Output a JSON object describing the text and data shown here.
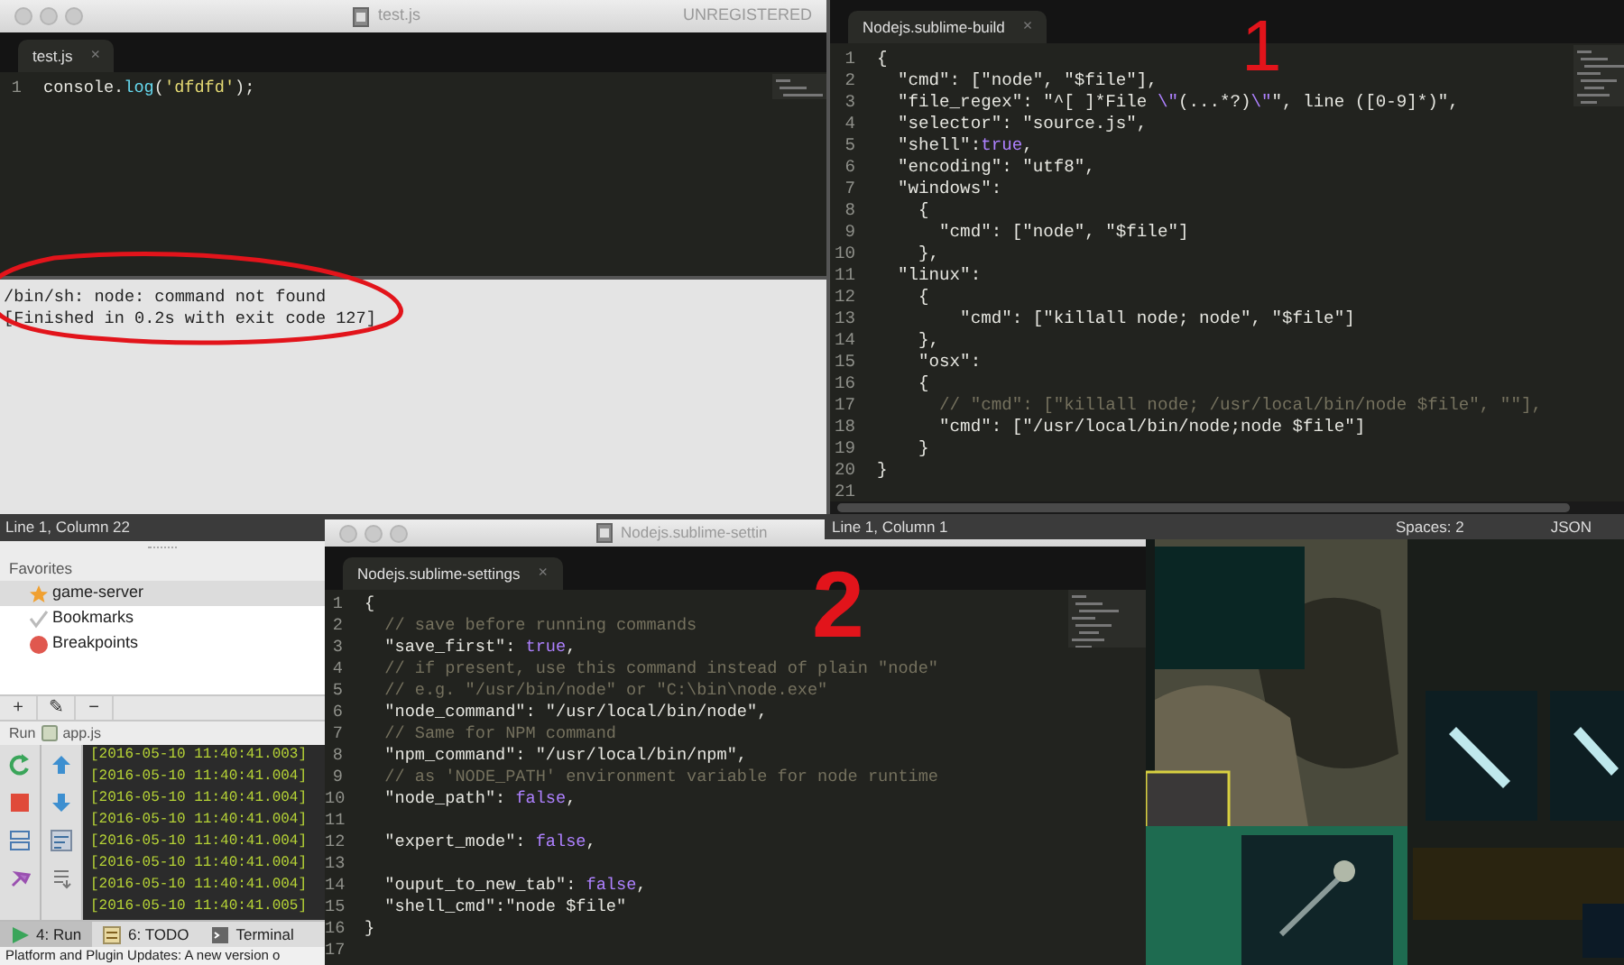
{
  "build_output_window": {
    "title": "test.js",
    "badge": "UNREGISTERED",
    "tabs": [
      {
        "label": "test.js",
        "close": "×",
        "selected": true
      }
    ],
    "lines": [
      {
        "n": "1",
        "tokens": [
          {
            "text": "console.",
            "kind": "text"
          },
          {
            "text": "log",
            "kind": "func"
          },
          {
            "text": "(",
            "kind": "text"
          },
          {
            "text": "'dfdfd'",
            "kind": "str"
          },
          {
            "text": ");",
            "kind": "text"
          }
        ]
      }
    ],
    "output": [
      "/bin/sh: node: command not found",
      "[Finished in 0.2s with exit code 127]"
    ],
    "status": "Line 1, Column 22"
  },
  "build_file_window": {
    "tabs": [
      {
        "label": "Nodejs.sublime-build",
        "close": "×",
        "selected": true
      }
    ],
    "lines": [
      {
        "n": "1",
        "tokens": [
          {
            "text": "{",
            "kind": "text"
          }
        ]
      },
      {
        "n": "2",
        "tokens": [
          {
            "text": "  \"cmd\": [\"node\", \"$file\"],",
            "kind": "text"
          }
        ]
      },
      {
        "n": "3",
        "tokens": [
          {
            "text": "  \"file_regex\": \"^[ ]*File ",
            "kind": "text"
          },
          {
            "text": "\\\"",
            "kind": "const"
          },
          {
            "text": "(...*?)",
            "kind": "text"
          },
          {
            "text": "\\\"",
            "kind": "const"
          },
          {
            "text": "\", line ([0-9]*)\",",
            "kind": "text"
          }
        ]
      },
      {
        "n": "4",
        "tokens": [
          {
            "text": "  \"selector\": \"source.js\",",
            "kind": "text"
          }
        ]
      },
      {
        "n": "5",
        "tokens": [
          {
            "text": "  \"shell\":",
            "kind": "text"
          },
          {
            "text": "true",
            "kind": "const"
          },
          {
            "text": ",",
            "kind": "text"
          }
        ]
      },
      {
        "n": "6",
        "tokens": [
          {
            "text": "  \"encoding\": \"utf8\",",
            "kind": "text"
          }
        ]
      },
      {
        "n": "7",
        "tokens": [
          {
            "text": "  \"windows\":",
            "kind": "text"
          }
        ]
      },
      {
        "n": "8",
        "tokens": [
          {
            "text": "    {",
            "kind": "text"
          }
        ]
      },
      {
        "n": "9",
        "tokens": [
          {
            "text": "      \"cmd\": [\"node\", \"$file\"]",
            "kind": "text"
          }
        ]
      },
      {
        "n": "10",
        "tokens": [
          {
            "text": "    },",
            "kind": "text"
          }
        ]
      },
      {
        "n": "11",
        "tokens": [
          {
            "text": "  \"linux\":",
            "kind": "text"
          }
        ]
      },
      {
        "n": "12",
        "tokens": [
          {
            "text": "    {",
            "kind": "text"
          }
        ]
      },
      {
        "n": "13",
        "tokens": [
          {
            "text": "        \"cmd\": [\"killall node; node\", \"$file\"]",
            "kind": "text"
          }
        ]
      },
      {
        "n": "14",
        "tokens": [
          {
            "text": "    },",
            "kind": "text"
          }
        ]
      },
      {
        "n": "15",
        "tokens": [
          {
            "text": "    \"osx\":",
            "kind": "text"
          }
        ]
      },
      {
        "n": "16",
        "tokens": [
          {
            "text": "    {",
            "kind": "text"
          }
        ]
      },
      {
        "n": "17",
        "tokens": [
          {
            "text": "      // \"cmd\": [\"killall node; /usr/local/bin/node $file\", \"\"],",
            "kind": "comment"
          }
        ]
      },
      {
        "n": "18",
        "tokens": [
          {
            "text": "      \"cmd\": [\"/usr/local/bin/node;node $file\"]",
            "kind": "text"
          }
        ]
      },
      {
        "n": "19",
        "tokens": [
          {
            "text": "    }",
            "kind": "text"
          }
        ]
      },
      {
        "n": "20",
        "tokens": [
          {
            "text": "}",
            "kind": "text"
          }
        ]
      },
      {
        "n": "21"
      }
    ],
    "status": {
      "position": "Line 1, Column 1",
      "indentation": "Spaces: 2",
      "syntax": "JSON"
    }
  },
  "ide_panel": {
    "favorites_title": "Favorites",
    "favorites": [
      {
        "label": "game-server",
        "kind": "star",
        "selected": true
      },
      {
        "label": "Bookmarks",
        "kind": "check",
        "selected": false
      },
      {
        "label": "Breakpoints",
        "kind": "breakpoint",
        "selected": false
      }
    ],
    "toolbar": [
      "+",
      "✎",
      "−"
    ],
    "run_label": "Run",
    "run_config": "app.js",
    "log": [
      "[2016-05-10 11:40:41.003]",
      "[2016-05-10 11:40:41.004]",
      "[2016-05-10 11:40:41.004]",
      "[2016-05-10 11:40:41.004]",
      "[2016-05-10 11:40:41.004]",
      "[2016-05-10 11:40:41.004]",
      "[2016-05-10 11:40:41.004]",
      "[2016-05-10 11:40:41.005]"
    ],
    "tool_tabs": [
      {
        "label": "4: Run",
        "kind": "run",
        "selected": true
      },
      {
        "label": "6: TODO",
        "kind": "todo",
        "selected": false
      },
      {
        "label": "Terminal",
        "kind": "terminal",
        "selected": false
      }
    ],
    "status": "Platform and Plugin Updates: A new version o"
  },
  "settings_window": {
    "title": "Nodejs.sublime-settin",
    "tabs": [
      {
        "label": "Nodejs.sublime-settings",
        "close": "×",
        "selected": true
      }
    ],
    "lines": [
      {
        "n": "1",
        "tokens": [
          {
            "text": "{",
            "kind": "text"
          }
        ]
      },
      {
        "n": "2",
        "tokens": [
          {
            "text": "  // save before running commands",
            "kind": "comment"
          }
        ]
      },
      {
        "n": "3",
        "tokens": [
          {
            "text": "  \"save_first\": ",
            "kind": "text"
          },
          {
            "text": "true",
            "kind": "const"
          },
          {
            "text": ",",
            "kind": "text"
          }
        ]
      },
      {
        "n": "4",
        "tokens": [
          {
            "text": "  // if present, use this command instead of plain \"node\"",
            "kind": "comment"
          }
        ]
      },
      {
        "n": "5",
        "tokens": [
          {
            "text": "  // e.g. \"/usr/bin/node\" or \"C:\\bin\\node.exe\"",
            "kind": "comment"
          }
        ]
      },
      {
        "n": "6",
        "tokens": [
          {
            "text": "  \"node_command\": \"/usr/local/bin/node\",",
            "kind": "text"
          }
        ]
      },
      {
        "n": "7",
        "tokens": [
          {
            "text": "  // Same for NPM command",
            "kind": "comment"
          }
        ]
      },
      {
        "n": "8",
        "tokens": [
          {
            "text": "  \"npm_command\": \"/usr/local/bin/npm\",",
            "kind": "text"
          }
        ]
      },
      {
        "n": "9",
        "tokens": [
          {
            "text": "  // as 'NODE_PATH' environment variable for node runtime",
            "kind": "comment"
          }
        ]
      },
      {
        "n": "10",
        "tokens": [
          {
            "text": "  \"node_path\": ",
            "kind": "text"
          },
          {
            "text": "false",
            "kind": "const"
          },
          {
            "text": ",",
            "kind": "text"
          }
        ]
      },
      {
        "n": "11"
      },
      {
        "n": "12",
        "tokens": [
          {
            "text": "  \"expert_mode\": ",
            "kind": "text"
          },
          {
            "text": "false",
            "kind": "const"
          },
          {
            "text": ",",
            "kind": "text"
          }
        ]
      },
      {
        "n": "13"
      },
      {
        "n": "14",
        "tokens": [
          {
            "text": "  \"ouput_to_new_tab\": ",
            "kind": "text"
          },
          {
            "text": "false",
            "kind": "const"
          },
          {
            "text": ",",
            "kind": "text"
          }
        ]
      },
      {
        "n": "15",
        "tokens": [
          {
            "text": "  \"shell_cmd\":\"node $file\"",
            "kind": "text"
          }
        ]
      },
      {
        "n": "16",
        "tokens": [
          {
            "text": "}",
            "kind": "text"
          }
        ]
      },
      {
        "n": "17"
      }
    ]
  },
  "annotations": [
    {
      "kind": "ellipse"
    },
    {
      "kind": "digit",
      "text": "1"
    },
    {
      "kind": "digit",
      "text": "2"
    }
  ]
}
